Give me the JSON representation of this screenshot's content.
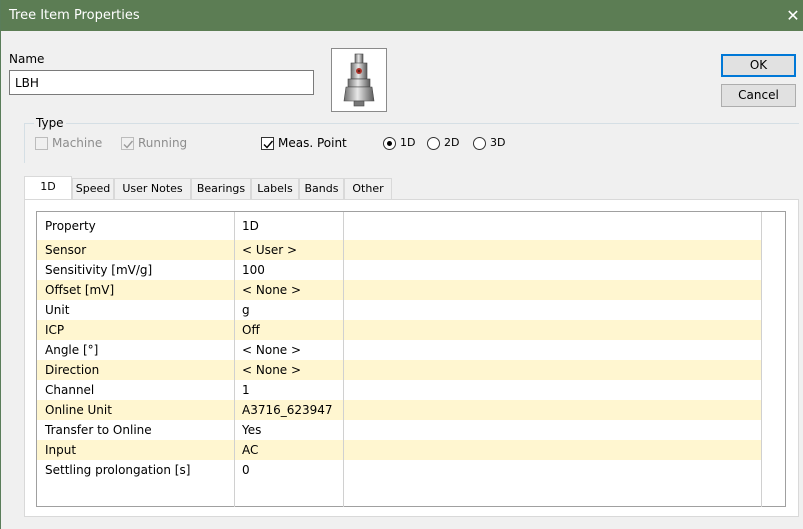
{
  "window": {
    "title": "Tree Item Properties",
    "close_glyph": "✕"
  },
  "name_section": {
    "label": "Name",
    "value": "LBH"
  },
  "buttons": {
    "ok": "OK",
    "cancel": "Cancel"
  },
  "type_section": {
    "label": "Type",
    "machine": {
      "label": "Machine",
      "checked": false,
      "enabled": false
    },
    "running": {
      "label": "Running",
      "checked": true,
      "enabled": false
    },
    "meas_point": {
      "label": "Meas. Point",
      "checked": true,
      "enabled": true
    },
    "dimensions": [
      {
        "label": "1D",
        "selected": true
      },
      {
        "label": "2D",
        "selected": false
      },
      {
        "label": "3D",
        "selected": false
      }
    ]
  },
  "tabs": [
    {
      "label": "1D",
      "active": true
    },
    {
      "label": "Speed",
      "active": false
    },
    {
      "label": "User Notes",
      "active": false
    },
    {
      "label": "Bearings",
      "active": false
    },
    {
      "label": "Labels",
      "active": false
    },
    {
      "label": "Bands",
      "active": false
    },
    {
      "label": "Other",
      "active": false
    }
  ],
  "grid": {
    "headers": [
      "Property",
      "1D"
    ],
    "rows": [
      {
        "property": "Sensor",
        "value": "< User >"
      },
      {
        "property": "Sensitivity [mV/g]",
        "value": "100"
      },
      {
        "property": "Offset [mV]",
        "value": "< None >"
      },
      {
        "property": "Unit",
        "value": "g"
      },
      {
        "property": "ICP",
        "value": "Off"
      },
      {
        "property": "Angle [°]",
        "value": "< None >"
      },
      {
        "property": "Direction",
        "value": "< None >"
      },
      {
        "property": "Channel",
        "value": "1"
      },
      {
        "property": "Online Unit",
        "value": "A3716_623947"
      },
      {
        "property": "Transfer to Online",
        "value": "Yes"
      },
      {
        "property": "Input",
        "value": "AC"
      },
      {
        "property": "Settling prolongation [s]",
        "value": "0"
      }
    ]
  },
  "colors": {
    "titlebar": "#5c7d54",
    "row_highlight": "#fff6d0",
    "default_button_border": "#0078d7"
  }
}
